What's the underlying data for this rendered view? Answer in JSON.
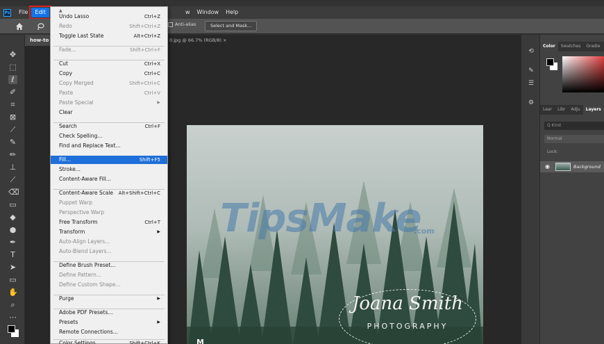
{
  "app": {
    "logo": "Ps"
  },
  "menubar": {
    "items": [
      "File",
      "Edit"
    ],
    "rest": [
      "w",
      "Window",
      "Help"
    ]
  },
  "options": {
    "antialias": "Anti-alias",
    "select_mask": "Select and Mask..."
  },
  "tabs": {
    "active": "how-to",
    "doc": "0.jpg @ 66.7% (RGB/8)  ×"
  },
  "image": {
    "watermark": "TipsMake",
    "watermark_tld": ".com",
    "signature_name": "Joana Smith",
    "signature_sub": "PHOTOGRAPHY",
    "corner_letter": "M"
  },
  "panels": {
    "color_tabs": [
      "Color",
      "Swatches",
      "Gradie"
    ],
    "layer_tabs": [
      "Lear",
      "Libr",
      "Adju",
      "Layers"
    ],
    "search": "Q Kind",
    "mode": "Normal",
    "lock": "Lock:",
    "layer_name": "Background"
  },
  "edit_menu": {
    "items": [
      {
        "label": "Undo Lasso",
        "shortcut": "Ctrl+Z",
        "state": "on"
      },
      {
        "label": "Redo",
        "shortcut": "Shift+Ctrl+Z",
        "state": "dis"
      },
      {
        "label": "Toggle Last State",
        "shortcut": "Alt+Ctrl+Z",
        "state": "on"
      },
      {
        "label": "Fade...",
        "shortcut": "Shift+Ctrl+F",
        "state": "dis"
      },
      {
        "label": "Cut",
        "shortcut": "Ctrl+X",
        "state": "on"
      },
      {
        "label": "Copy",
        "shortcut": "Ctrl+C",
        "state": "on"
      },
      {
        "label": "Copy Merged",
        "shortcut": "Shift+Ctrl+C",
        "state": "dis"
      },
      {
        "label": "Paste",
        "shortcut": "Ctrl+V",
        "state": "dis"
      },
      {
        "label": "Paste Special",
        "shortcut": "",
        "state": "dis",
        "submenu": true
      },
      {
        "label": "Clear",
        "shortcut": "",
        "state": "on"
      },
      {
        "label": "Search",
        "shortcut": "Ctrl+F",
        "state": "on"
      },
      {
        "label": "Check Spelling...",
        "shortcut": "",
        "state": "on"
      },
      {
        "label": "Find and Replace Text...",
        "shortcut": "",
        "state": "on"
      },
      {
        "label": "Fill...",
        "shortcut": "Shift+F5",
        "state": "hi"
      },
      {
        "label": "Stroke...",
        "shortcut": "",
        "state": "on"
      },
      {
        "label": "Content-Aware Fill...",
        "shortcut": "",
        "state": "on"
      },
      {
        "label": "Content-Aware Scale",
        "shortcut": "Alt+Shift+Ctrl+C",
        "state": "on"
      },
      {
        "label": "Puppet Warp",
        "shortcut": "",
        "state": "dis"
      },
      {
        "label": "Perspective Warp",
        "shortcut": "",
        "state": "dis"
      },
      {
        "label": "Free Transform",
        "shortcut": "Ctrl+T",
        "state": "on"
      },
      {
        "label": "Transform",
        "shortcut": "",
        "state": "on",
        "submenu": true
      },
      {
        "label": "Auto-Align Layers...",
        "shortcut": "",
        "state": "dis"
      },
      {
        "label": "Auto-Blend Layers...",
        "shortcut": "",
        "state": "dis"
      },
      {
        "label": "Define Brush Preset...",
        "shortcut": "",
        "state": "on"
      },
      {
        "label": "Define Pattern...",
        "shortcut": "",
        "state": "dis"
      },
      {
        "label": "Define Custom Shape...",
        "shortcut": "",
        "state": "dis"
      },
      {
        "label": "Purge",
        "shortcut": "",
        "state": "on",
        "submenu": true
      },
      {
        "label": "Adobe PDF Presets...",
        "shortcut": "",
        "state": "on"
      },
      {
        "label": "Presets",
        "shortcut": "",
        "state": "on",
        "submenu": true
      },
      {
        "label": "Remote Connections...",
        "shortcut": "",
        "state": "on"
      },
      {
        "label": "Color Settings...",
        "shortcut": "Shift+Ctrl+K",
        "state": "on"
      }
    ]
  },
  "colors": {
    "accent": "#1e6fd9",
    "highlight_outline": "#e02020"
  }
}
